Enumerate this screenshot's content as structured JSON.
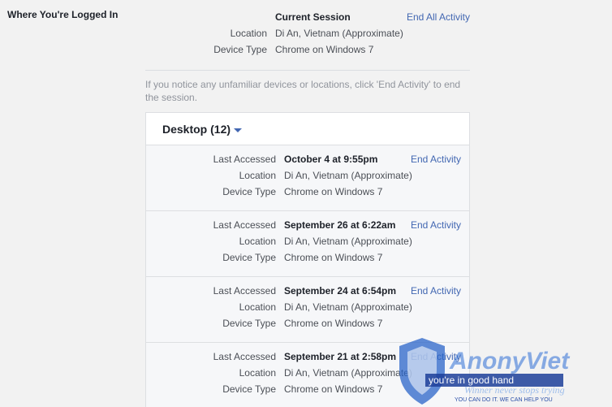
{
  "section_title": "Where You're Logged In",
  "current": {
    "heading": "Current Session",
    "end_all": "End All Activity",
    "location_label": "Location",
    "location_value": "Di An, Vietnam (Approximate)",
    "device_label": "Device Type",
    "device_value": "Chrome on Windows 7"
  },
  "notice": "If you notice any unfamiliar devices or locations, click 'End Activity' to end the session.",
  "desktop": {
    "title": "Desktop (12)",
    "entries": [
      {
        "accessed_label": "Last Accessed",
        "accessed": "October 4 at 9:55pm",
        "end": "End Activity",
        "location_label": "Location",
        "location": "Di An, Vietnam (Approximate)",
        "device_label": "Device Type",
        "device": "Chrome on Windows 7"
      },
      {
        "accessed_label": "Last Accessed",
        "accessed": "September 26 at 6:22am",
        "end": "End Activity",
        "location_label": "Location",
        "location": "Di An, Vietnam (Approximate)",
        "device_label": "Device Type",
        "device": "Chrome on Windows 7"
      },
      {
        "accessed_label": "Last Accessed",
        "accessed": "September 24 at 6:54pm",
        "end": "End Activity",
        "location_label": "Location",
        "location": "Di An, Vietnam (Approximate)",
        "device_label": "Device Type",
        "device": "Chrome on Windows 7"
      },
      {
        "accessed_label": "Last Accessed",
        "accessed": "September 21 at 2:58pm",
        "end": "End Activity",
        "location_label": "Location",
        "location": "Di An, Vietnam (Approximate)",
        "device_label": "Device Type",
        "device": "Chrome on Windows 7"
      }
    ]
  },
  "watermark": {
    "brand": "AnonyViet",
    "tagline": "you're in good hand",
    "slogan": "Winner never stops trying",
    "motto": "YOU CAN DO IT. WE CAN HELP YOU"
  },
  "colors": {
    "link": "#4267b2",
    "background": "#f2f2f2"
  }
}
